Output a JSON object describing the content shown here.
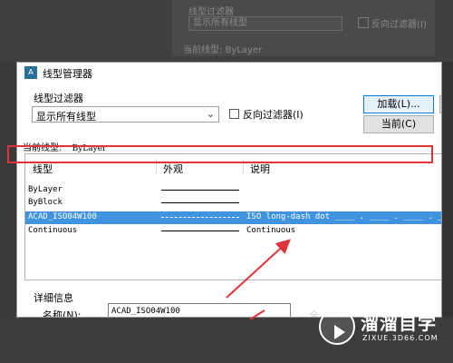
{
  "background": {
    "filter_label": "线型过滤器",
    "filter_value": "显示所有线型",
    "invert_label": "反向过滤器(I)",
    "current_line": "当前线型:  ByLayer"
  },
  "dialog": {
    "title": "线型管理器",
    "filter_label": "线型过滤器",
    "filter_value": "显示所有线型",
    "invert_label": "反向过滤器(I)",
    "load_button": "加载(L)...",
    "current_button": "当前(C)",
    "current_linetype_label": "当前线型:",
    "current_linetype_value": "ByLayer",
    "columns": {
      "linetype": "线型",
      "appearance": "外观",
      "description": "说明"
    },
    "rows": [
      {
        "name": "ByLayer",
        "description": "",
        "selected": false
      },
      {
        "name": "ByBlock",
        "description": "",
        "selected": false
      },
      {
        "name": "ACAD_ISO04W100",
        "description": "ISO long-dash dot ____ . ____ . ____ . _",
        "selected": true
      },
      {
        "name": "Continuous",
        "description": "Continuous",
        "selected": false
      }
    ],
    "details_label": "详细信息",
    "name_label": "名称(N):",
    "name_value": "ACAD_ISO04W100",
    "details_right": "全"
  },
  "colors": {
    "selection": "#3f93df",
    "annotation": "#e0343c"
  },
  "watermark": {
    "brand": "溜溜自学",
    "site": "ZIXUE.3D66.COM"
  }
}
